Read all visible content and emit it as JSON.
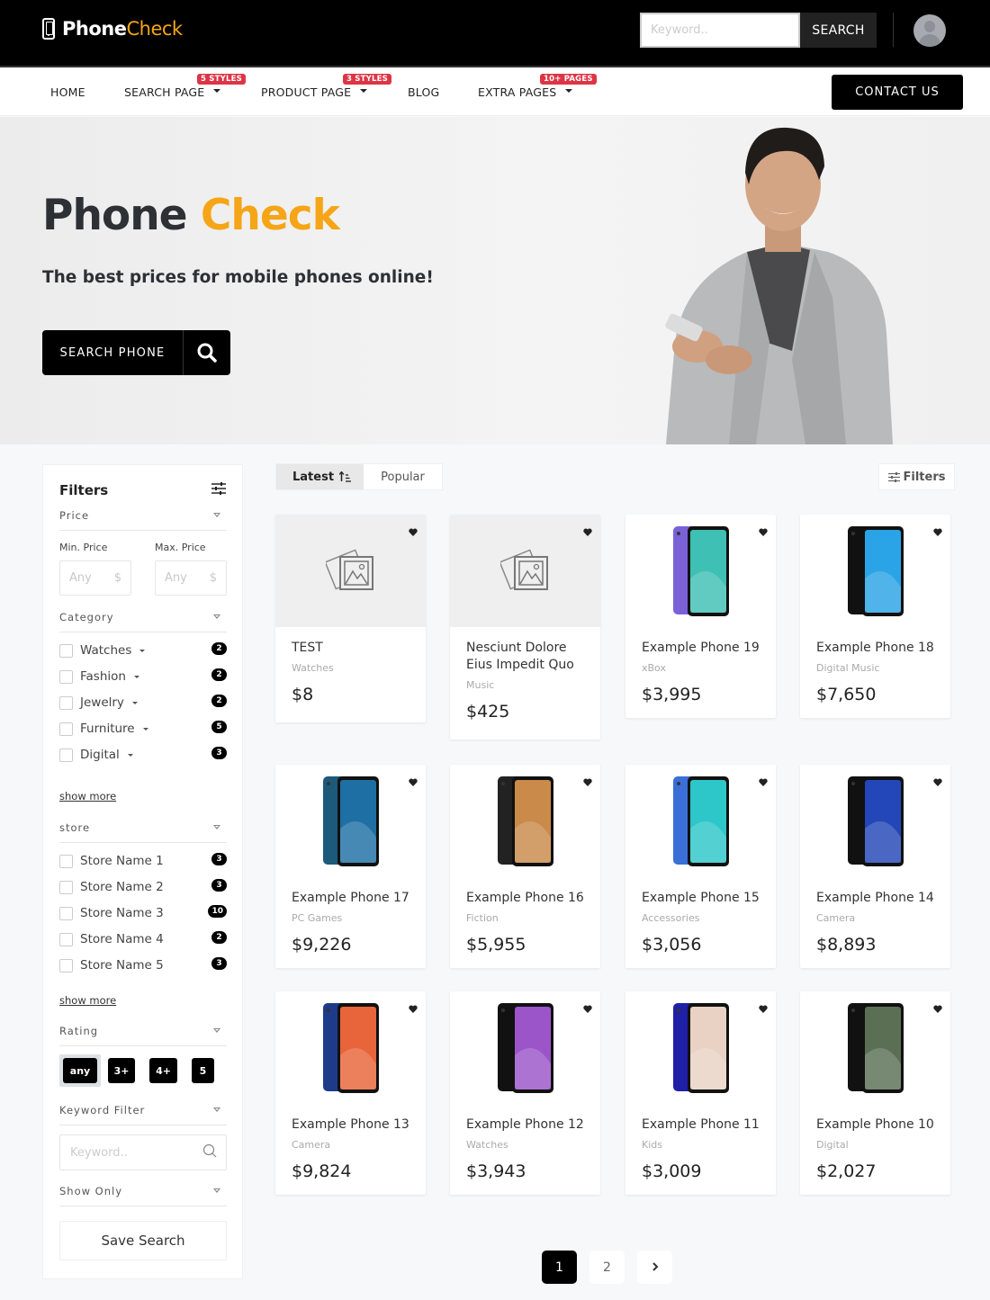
{
  "brand": {
    "name_part1": "Phone",
    "name_part2": "Check"
  },
  "top_search": {
    "placeholder": "Keyword..",
    "button_label": "SEARCH"
  },
  "nav": {
    "items": [
      {
        "label": "HOME",
        "badge": null,
        "has_dropdown": false
      },
      {
        "label": "SEARCH PAGE",
        "badge": "5 STYLES",
        "has_dropdown": true
      },
      {
        "label": "PRODUCT PAGE",
        "badge": "3 STYLES",
        "has_dropdown": true
      },
      {
        "label": "BLOG",
        "badge": null,
        "has_dropdown": false
      },
      {
        "label": "EXTRA PAGES",
        "badge": "10+ PAGES",
        "has_dropdown": true
      }
    ],
    "contact_label": "CONTACT US"
  },
  "hero": {
    "title_part1": "Phone",
    "title_part2": "Check",
    "subtitle": "The best prices for mobile phones online!",
    "button_label": "SEARCH PHONE"
  },
  "sidebar": {
    "title": "Filters",
    "price": {
      "section": "Price",
      "min_label": "Min. Price",
      "max_label": "Max. Price",
      "min_placeholder": "Any",
      "max_placeholder": "Any",
      "currency": "$"
    },
    "category": {
      "section": "Category",
      "items": [
        {
          "label": "Watches",
          "count": "2"
        },
        {
          "label": "Fashion",
          "count": "2"
        },
        {
          "label": "Jewelry",
          "count": "2"
        },
        {
          "label": "Furniture",
          "count": "5"
        },
        {
          "label": "Digital",
          "count": "3"
        }
      ],
      "show_more": "show more"
    },
    "store": {
      "section": "store",
      "items": [
        {
          "label": "Store Name 1",
          "count": "3"
        },
        {
          "label": "Store Name 2",
          "count": "3"
        },
        {
          "label": "Store Name 3",
          "count": "10"
        },
        {
          "label": "Store Name 4",
          "count": "2"
        },
        {
          "label": "Store Name 5",
          "count": "3"
        }
      ],
      "show_more": "show more"
    },
    "rating": {
      "section": "Rating",
      "options": [
        "any",
        "3+",
        "4+",
        "5"
      ],
      "selected": "any"
    },
    "keyword": {
      "section": "Keyword Filter",
      "placeholder": "Keyword.."
    },
    "show_only": {
      "section": "Show Only"
    },
    "save_label": "Save Search"
  },
  "toolbar": {
    "tab_latest": "Latest",
    "tab_popular": "Popular",
    "filters_label": "Filters"
  },
  "products": [
    {
      "title": "TEST",
      "category": "Watches",
      "price": "$8",
      "image": "placeholder"
    },
    {
      "title": "Nesciunt Dolore Eius Impedit Quo",
      "category": "Music",
      "price": "$425",
      "image": "placeholder"
    },
    {
      "title": "Example Phone 19",
      "category": "xBox",
      "price": "$3,995",
      "image": "phone",
      "colors": [
        "#7b61d8",
        "#3fc0b4"
      ]
    },
    {
      "title": "Example Phone 18",
      "category": "Digital Music",
      "price": "$7,650",
      "image": "phone",
      "colors": [
        "#111111",
        "#2aa4e6"
      ]
    },
    {
      "title": "Example Phone 17",
      "category": "PC Games",
      "price": "$9,226",
      "image": "phone",
      "colors": [
        "#1b5a7a",
        "#1e6fa4"
      ]
    },
    {
      "title": "Example Phone 16",
      "category": "Fiction",
      "price": "$5,955",
      "image": "phone",
      "colors": [
        "#222222",
        "#c98a4a"
      ]
    },
    {
      "title": "Example Phone 15",
      "category": "Accessories",
      "price": "$3,056",
      "image": "phone",
      "colors": [
        "#3b6fd8",
        "#2dc6c9"
      ]
    },
    {
      "title": "Example Phone 14",
      "category": "Camera",
      "price": "$8,893",
      "image": "phone",
      "colors": [
        "#111111",
        "#2346b8"
      ]
    },
    {
      "title": "Example Phone 13",
      "category": "Camera",
      "price": "$9,824",
      "image": "phone",
      "colors": [
        "#1d3b8a",
        "#e8643a"
      ]
    },
    {
      "title": "Example Phone 12",
      "category": "Watches",
      "price": "$3,943",
      "image": "phone",
      "colors": [
        "#111111",
        "#9b55c9"
      ]
    },
    {
      "title": "Example Phone 11",
      "category": "Kids",
      "price": "$3,009",
      "image": "phone",
      "colors": [
        "#1f1fa8",
        "#e9d2c4"
      ]
    },
    {
      "title": "Example Phone 10",
      "category": "Digital",
      "price": "$2,027",
      "image": "phone",
      "colors": [
        "#111111",
        "#5b6f55"
      ]
    }
  ],
  "pagination": {
    "pages": [
      "1",
      "2"
    ],
    "current": "1",
    "next_label": "›"
  },
  "colors": {
    "accent": "#f5a516",
    "badge": "#dc3545",
    "dark": "#000000"
  }
}
